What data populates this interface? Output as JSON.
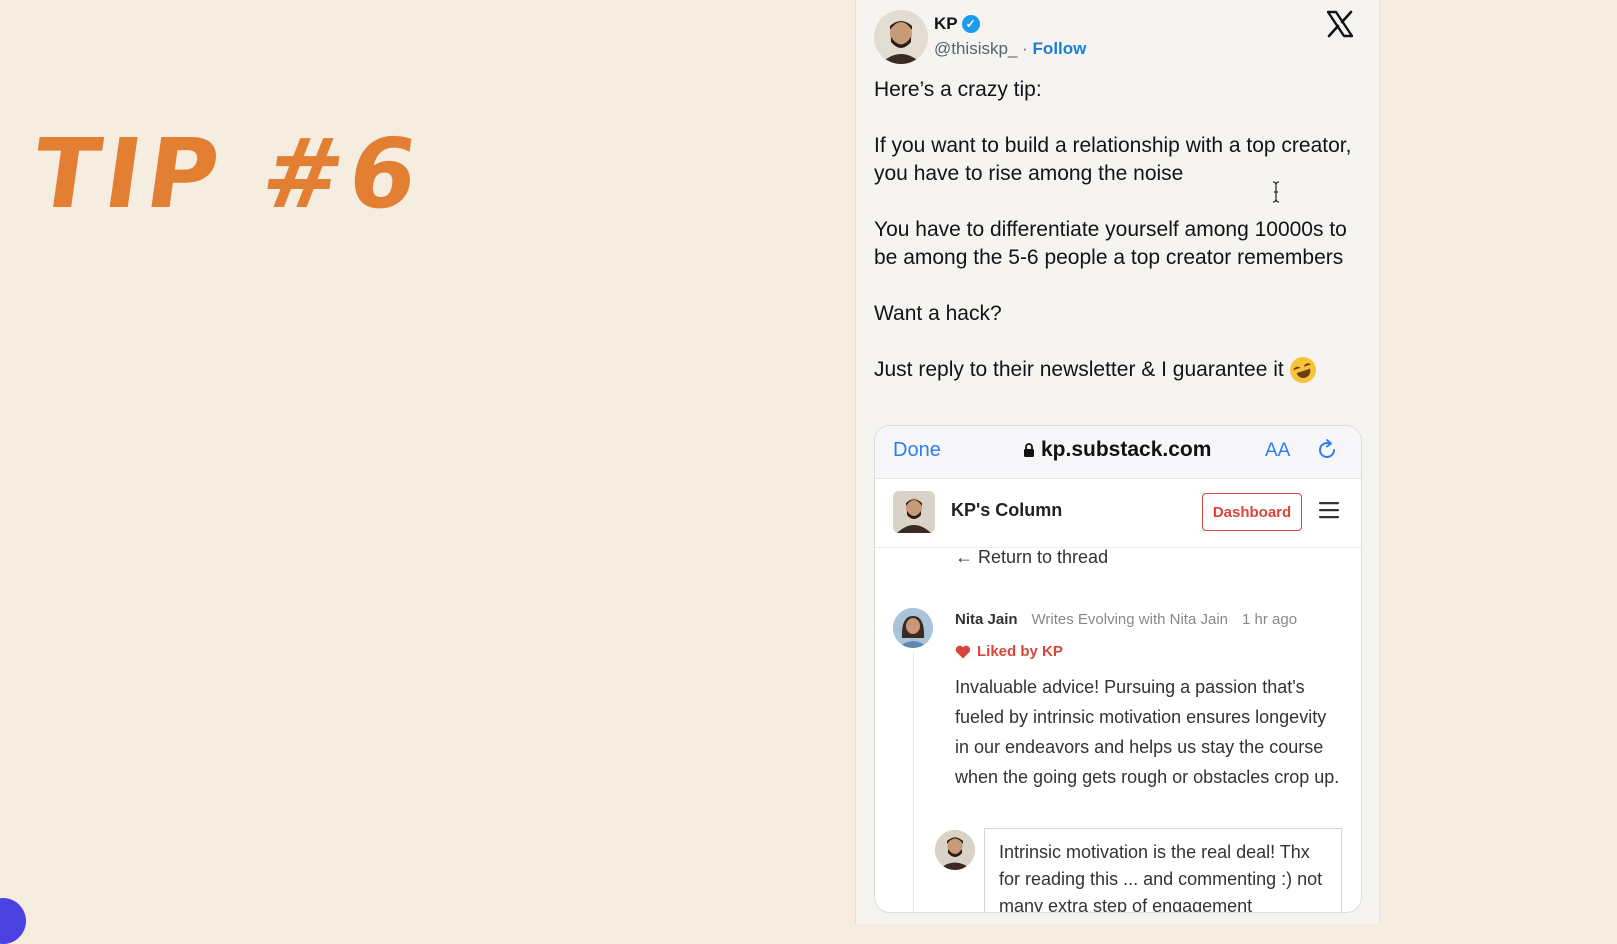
{
  "slide": {
    "title": "TIP #6"
  },
  "tweet": {
    "author_name": "KP",
    "handle": "@thisiskp_",
    "separator": "·",
    "follow_label": "Follow",
    "verified_icon": "verified-check-icon",
    "platform_icon": "x-logo-icon",
    "body": [
      "Here’s a crazy tip:",
      "If you want to build a relationship with a top creator, you have to rise among the noise",
      "You have to differentiate yourself among 10000s to be among the 5-6 people a top creator remembers",
      "Want a hack?",
      "Just reply to their newsletter & I guarantee it"
    ],
    "emoji_icon": "rolling-on-floor-laughing-emoji"
  },
  "embed": {
    "browser": {
      "done_label": "Done",
      "url": "kp.substack.com",
      "text_size_label": "AA"
    },
    "site": {
      "title": "KP's Column",
      "dashboard_label": "Dashboard",
      "return_link": "← Return to thread"
    },
    "comment": {
      "author": "Nita Jain",
      "author_desc": "Writes Evolving with Nita Jain",
      "time": "1 hr ago",
      "liked_by": "Liked by KP",
      "text": "Invaluable advice! Pursuing a passion that's fueled by intrinsic motivation ensures longevity in our endeavors and helps us stay the course when the going gets rough or obstacles crop up."
    },
    "reply": {
      "text": "Intrinsic motivation is the real deal! Thx for reading this ... and commenting :) not many extra step of engagement"
    }
  },
  "colors": {
    "background": "#f4ede0",
    "title_orange": "#e27f33",
    "link_blue": "#1d7ed6",
    "substack_red": "#d8453b"
  }
}
